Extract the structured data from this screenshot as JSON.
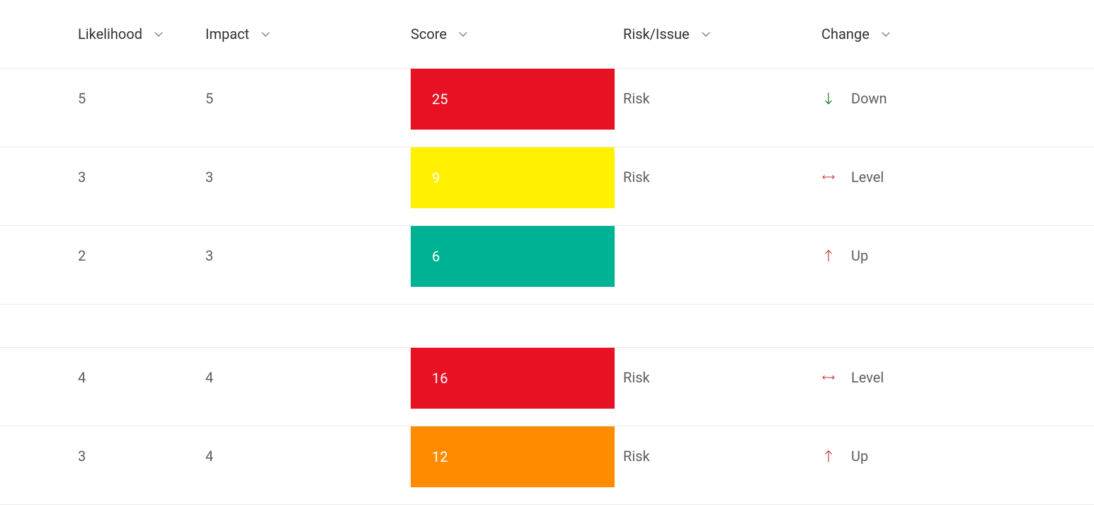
{
  "columns": {
    "likelihood": "Likelihood",
    "impact": "Impact",
    "score": "Score",
    "risk_issue": "Risk/Issue",
    "change": "Change"
  },
  "colors": {
    "red": "#e81123",
    "yellow": "#fff100",
    "teal": "#00b294",
    "orange": "#ff8c00",
    "arrow_down": "#107c10",
    "arrow_up": "#d13438",
    "arrow_level": "#d13438"
  },
  "rows": [
    {
      "likelihood": "5",
      "impact": "5",
      "score": "25",
      "score_color": "red",
      "risk_issue": "Risk",
      "change": "Down",
      "change_icon": "down"
    },
    {
      "likelihood": "3",
      "impact": "3",
      "score": "9",
      "score_color": "yellow",
      "risk_issue": "Risk",
      "change": "Level",
      "change_icon": "level"
    },
    {
      "likelihood": "2",
      "impact": "3",
      "score": "6",
      "score_color": "teal",
      "risk_issue": "",
      "change": "Up",
      "change_icon": "up"
    },
    {
      "gap": true
    },
    {
      "likelihood": "4",
      "impact": "4",
      "score": "16",
      "score_color": "red",
      "risk_issue": "Risk",
      "change": "Level",
      "change_icon": "level"
    },
    {
      "likelihood": "3",
      "impact": "4",
      "score": "12",
      "score_color": "orange",
      "risk_issue": "Risk",
      "change": "Up",
      "change_icon": "up"
    }
  ]
}
